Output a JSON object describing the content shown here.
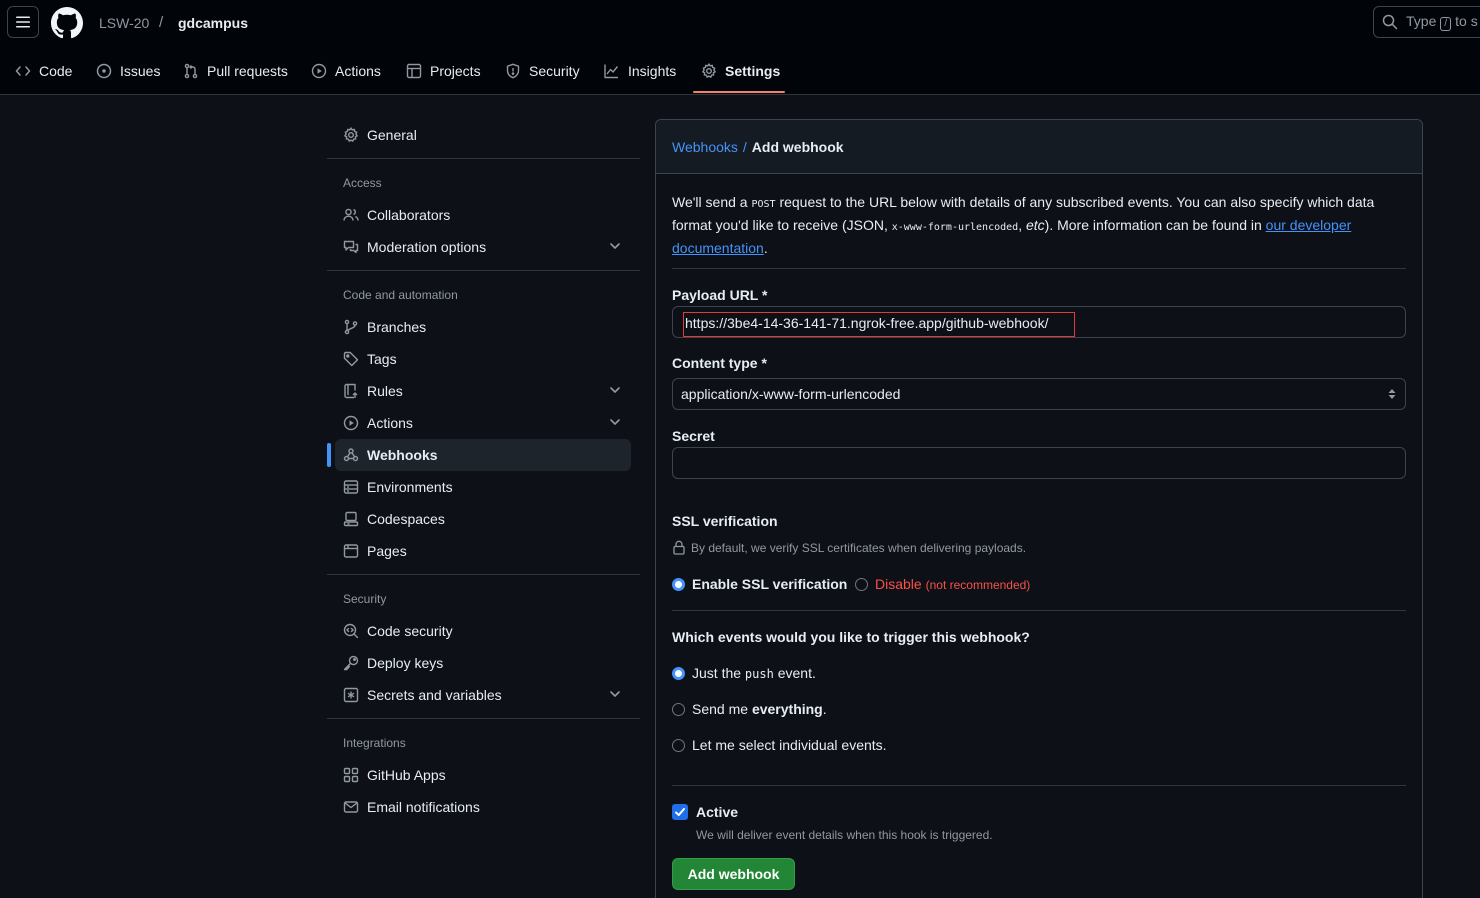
{
  "header": {
    "owner": "LSW-20",
    "separator": "/",
    "repo": "gdcampus",
    "search": {
      "text_before": "Type",
      "shortcut": "/",
      "text_after": "to s"
    }
  },
  "repo_nav": {
    "tabs": [
      {
        "label": "Code",
        "icon": "code-icon"
      },
      {
        "label": "Issues",
        "icon": "issue-opened-icon"
      },
      {
        "label": "Pull requests",
        "icon": "git-pull-request-icon"
      },
      {
        "label": "Actions",
        "icon": "play-icon"
      },
      {
        "label": "Projects",
        "icon": "table-icon"
      },
      {
        "label": "Security",
        "icon": "shield-icon"
      },
      {
        "label": "Insights",
        "icon": "graph-icon"
      },
      {
        "label": "Settings",
        "icon": "gear-icon",
        "selected": true
      }
    ],
    "accent": "#f78166"
  },
  "sidebar": {
    "general": "General",
    "headings": {
      "access": "Access",
      "code_automation": "Code and automation",
      "security": "Security",
      "integrations": "Integrations"
    },
    "items": {
      "collaborators": "Collaborators",
      "moderation": "Moderation options",
      "branches": "Branches",
      "tags": "Tags",
      "rules": "Rules",
      "actions": "Actions",
      "webhooks": "Webhooks",
      "environments": "Environments",
      "codespaces": "Codespaces",
      "pages": "Pages",
      "code_security": "Code security",
      "deploy_keys": "Deploy keys",
      "secrets": "Secrets and variables",
      "github_apps": "GitHub Apps",
      "email_notifications": "Email notifications"
    },
    "active": "Webhooks",
    "active_color": "#4493f8"
  },
  "main": {
    "breadcrumb": {
      "parent": "Webhooks",
      "separator": "/",
      "current": "Add webhook"
    },
    "intro": {
      "t1": "We'll send a ",
      "code1": "POST",
      "t2": " request to the URL below with details of any subscribed events. You can also specify which data format you'd like to receive (JSON, ",
      "code2": "x-www-form-urlencoded",
      "t3": ", ",
      "etc": "etc",
      "t4": "). More information can be found in ",
      "link": "our developer documentation",
      "t5": "."
    },
    "payload_url": {
      "label": "Payload URL *",
      "value": "https://3be4-14-36-141-71.ngrok-free.app/github-webhook/"
    },
    "content_type": {
      "label": "Content type *",
      "value": "application/x-www-form-urlencoded"
    },
    "secret": {
      "label": "Secret",
      "value": ""
    },
    "ssl": {
      "title": "SSL verification",
      "note": "By default, we verify SSL certificates when delivering payloads.",
      "enable_label": "Enable SSL verification",
      "disable_label": "Disable",
      "disable_hint": "(not recommended)",
      "selected": "enable"
    },
    "events": {
      "question": "Which events would you like to trigger this webhook?",
      "option1_pre": "Just the ",
      "option1_code": "push",
      "option1_post": " event.",
      "option2_pre": "Send me ",
      "option2_bold": "everything",
      "option2_post": ".",
      "option3": "Let me select individual events.",
      "selected": "push"
    },
    "active": {
      "label": "Active",
      "checked": true,
      "note": "We will deliver event details when this hook is triggered."
    },
    "submit_label": "Add webhook",
    "submit_color": "#238636"
  }
}
